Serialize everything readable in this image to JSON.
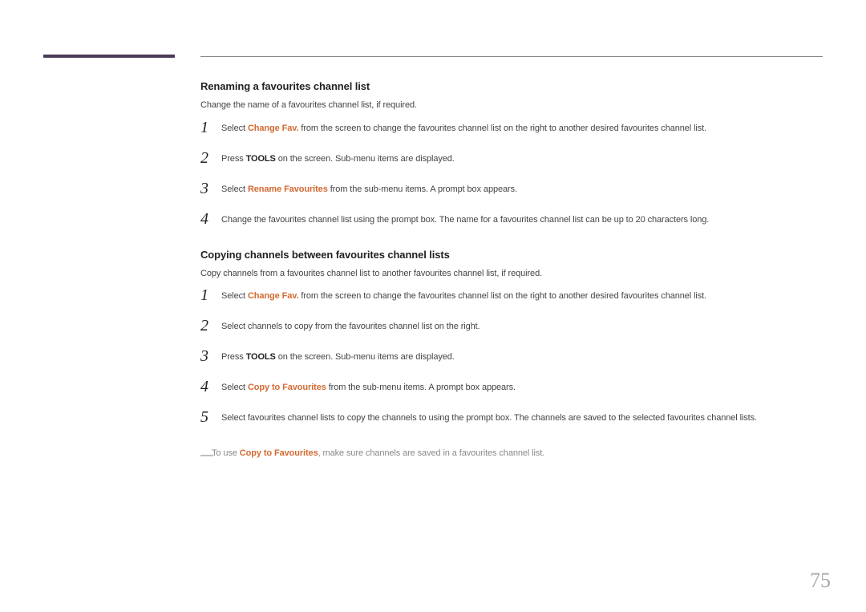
{
  "sections": [
    {
      "heading": "Renaming a favourites channel list",
      "intro": "Change the name of a favourites channel list, if required.",
      "steps": [
        {
          "num": "1",
          "pre": "Select ",
          "hi": "Change Fav.",
          "hi_class": "orange",
          "post": " from the screen to change the favourites channel list on the right to another desired favourites channel list."
        },
        {
          "num": "2",
          "pre": "Press ",
          "hi": "TOOLS",
          "hi_class": "bold",
          "post": " on the screen. Sub-menu items are displayed."
        },
        {
          "num": "3",
          "pre": "Select ",
          "hi": "Rename Favourites",
          "hi_class": "orange",
          "post": " from the sub-menu items. A prompt box appears."
        },
        {
          "num": "4",
          "pre": "",
          "hi": "",
          "hi_class": "",
          "post": "Change the favourites channel list using the prompt box. The name for a favourites channel list can be up to 20 characters long."
        }
      ]
    },
    {
      "heading": "Copying channels between favourites channel lists",
      "intro": "Copy channels from a favourites channel list to another favourites channel list, if required.",
      "steps": [
        {
          "num": "1",
          "pre": "Select ",
          "hi": "Change Fav.",
          "hi_class": "orange",
          "post": " from the screen to change the favourites channel list on the right to another desired favourites channel list."
        },
        {
          "num": "2",
          "pre": "",
          "hi": "",
          "hi_class": "",
          "post": "Select channels to copy from the favourites channel list on the right."
        },
        {
          "num": "3",
          "pre": "Press ",
          "hi": "TOOLS",
          "hi_class": "bold",
          "post": " on the screen. Sub-menu items are displayed."
        },
        {
          "num": "4",
          "pre": "Select ",
          "hi": "Copy to Favourites",
          "hi_class": "orange",
          "post": " from the sub-menu items. A prompt box appears."
        },
        {
          "num": "5",
          "pre": "",
          "hi": "",
          "hi_class": "",
          "post": "Select favourites channel lists to copy the channels to using the prompt box. The channels are saved to the selected favourites channel lists."
        }
      ]
    }
  ],
  "note": {
    "pre": "To use ",
    "hi": "Copy to Favourites",
    "post": ", make sure channels are saved in a favourites channel list."
  },
  "page_number": "75"
}
